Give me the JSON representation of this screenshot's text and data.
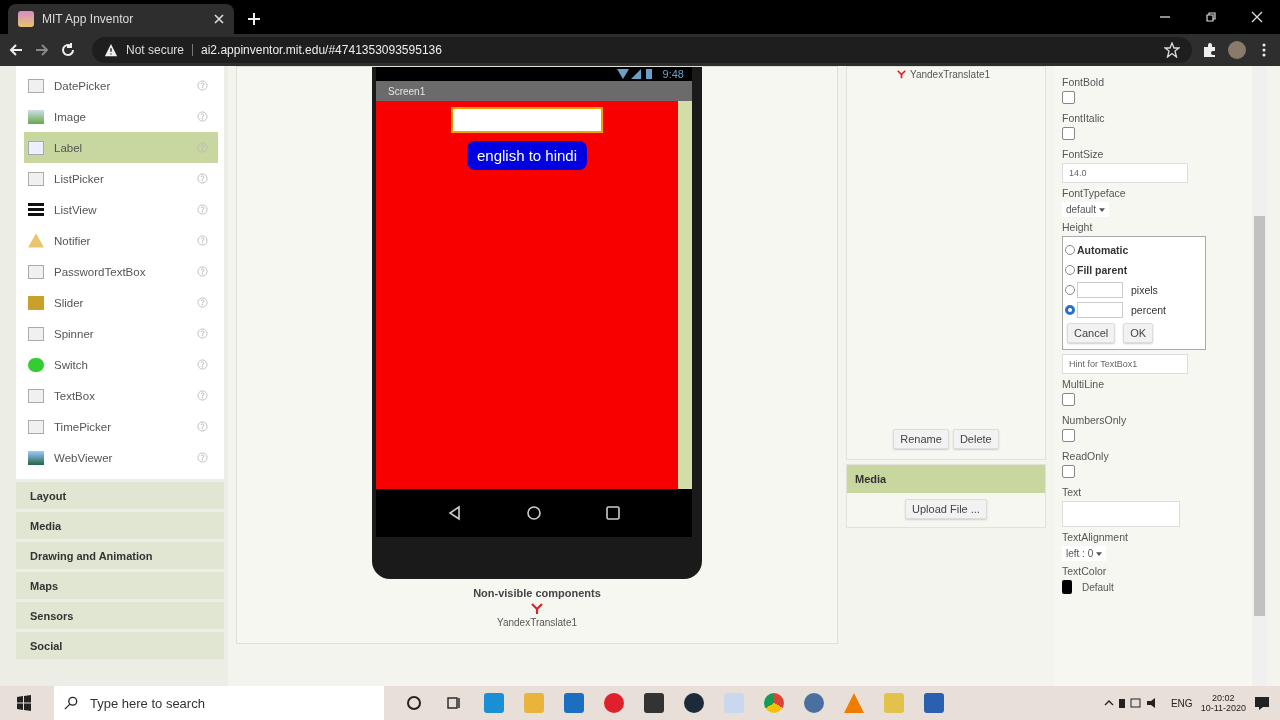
{
  "browser": {
    "tab_title": "MIT App Inventor",
    "security": "Not secure",
    "url": "ai2.appinventor.mit.edu/#4741353093595136"
  },
  "palette": {
    "items": [
      {
        "label": "DatePicker",
        "selected": false,
        "kind": "calendar"
      },
      {
        "label": "Image",
        "selected": false,
        "kind": "image"
      },
      {
        "label": "Label",
        "selected": true,
        "kind": "label"
      },
      {
        "label": "ListPicker",
        "selected": false,
        "kind": "list"
      },
      {
        "label": "ListView",
        "selected": false,
        "kind": "lines"
      },
      {
        "label": "Notifier",
        "selected": false,
        "kind": "warning"
      },
      {
        "label": "PasswordTextBox",
        "selected": false,
        "kind": "password"
      },
      {
        "label": "Slider",
        "selected": false,
        "kind": "slider"
      },
      {
        "label": "Spinner",
        "selected": false,
        "kind": "spinner"
      },
      {
        "label": "Switch",
        "selected": false,
        "kind": "switch"
      },
      {
        "label": "TextBox",
        "selected": false,
        "kind": "textbox"
      },
      {
        "label": "TimePicker",
        "selected": false,
        "kind": "calendar"
      },
      {
        "label": "WebViewer",
        "selected": false,
        "kind": "globe"
      }
    ],
    "categories": [
      "Layout",
      "Media",
      "Drawing and Animation",
      "Maps",
      "Sensors",
      "Social"
    ]
  },
  "viewer": {
    "status_time": "9:48",
    "screen_title": "Screen1",
    "button_text": "english to hindi",
    "nonvisible_heading": "Non-visible components",
    "nonvisible_component": "YandexTranslate1"
  },
  "components": {
    "tree_item": "YandexTranslate1",
    "buttons": [
      "Rename",
      "Delete"
    ]
  },
  "media": {
    "title": "Media",
    "upload_button": "Upload File ..."
  },
  "properties": [
    {
      "kind": "checkbox",
      "label": "FontBold",
      "checked": false
    },
    {
      "kind": "checkbox",
      "label": "FontItalic",
      "checked": false
    },
    {
      "kind": "field",
      "label": "FontSize",
      "value": "14.0"
    },
    {
      "kind": "dropdown",
      "label": "FontTypeface",
      "value": "default"
    },
    {
      "kind": "height",
      "label": "Height",
      "options": [
        {
          "label": "Automatic",
          "selected": false,
          "kind": "plain"
        },
        {
          "label": "Fill parent",
          "selected": false,
          "kind": "plain"
        },
        {
          "label": "pixels",
          "selected": false,
          "kind": "input"
        },
        {
          "label": "percent",
          "selected": true,
          "kind": "input"
        }
      ],
      "buttons": [
        "Cancel",
        "OK"
      ]
    },
    {
      "kind": "field",
      "value": "Hint for TextBox1"
    },
    {
      "kind": "checkbox",
      "label": "MultiLine",
      "checked": false
    },
    {
      "kind": "checkbox",
      "label": "NumbersOnly",
      "checked": false
    },
    {
      "kind": "checkbox",
      "label": "ReadOnly",
      "checked": false
    },
    {
      "kind": "textarea",
      "label": "Text"
    },
    {
      "kind": "dropdown",
      "label": "TextAlignment",
      "value": "left : 0"
    },
    {
      "kind": "color",
      "label": "TextColor",
      "value": "Default",
      "color": "#000000"
    }
  ],
  "taskbar": {
    "search_placeholder": "Type here to search",
    "language": "ENG",
    "time": "20:02",
    "date": "10-11-2020"
  }
}
